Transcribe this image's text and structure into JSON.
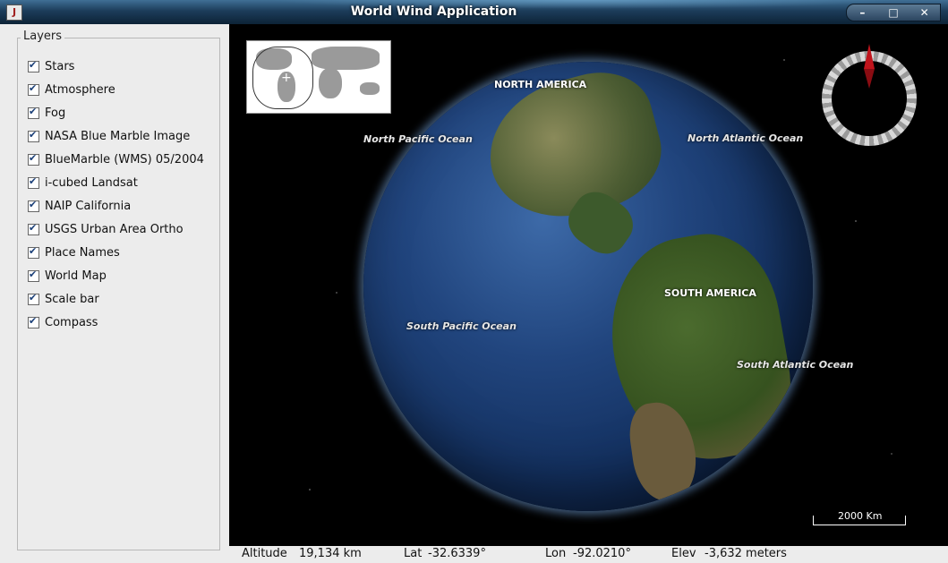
{
  "window": {
    "title": "World Wind Application"
  },
  "window_controls": {
    "minimize": "–",
    "maximize": "□",
    "close": "✕"
  },
  "layers_panel": {
    "title": "Layers",
    "items": [
      {
        "label": "Stars",
        "checked": true
      },
      {
        "label": "Atmosphere",
        "checked": true
      },
      {
        "label": "Fog",
        "checked": true
      },
      {
        "label": "NASA Blue Marble Image",
        "checked": true
      },
      {
        "label": "BlueMarble (WMS) 05/2004",
        "checked": true
      },
      {
        "label": "i-cubed Landsat",
        "checked": true
      },
      {
        "label": "NAIP California",
        "checked": true
      },
      {
        "label": "USGS Urban Area Ortho",
        "checked": true
      },
      {
        "label": "Place Names",
        "checked": true
      },
      {
        "label": "World Map",
        "checked": true
      },
      {
        "label": "Scale bar",
        "checked": true
      },
      {
        "label": "Compass",
        "checked": true
      }
    ]
  },
  "globe": {
    "labels": {
      "north_america": "NORTH AMERICA",
      "south_america": "SOUTH AMERICA",
      "north_pacific": "North Pacific Ocean",
      "north_atlantic": "North Atlantic Ocean",
      "south_pacific": "South Pacific Ocean",
      "south_atlantic": "South Atlantic Ocean"
    },
    "scale_bar": "2000 Km"
  },
  "status": {
    "altitude_label": "Altitude",
    "altitude_value": "19,134 km",
    "lat_label": "Lat",
    "lat_value": "-32.6339°",
    "lon_label": "Lon",
    "lon_value": "-92.0210°",
    "elev_label": "Elev",
    "elev_value": "-3,632 meters"
  },
  "colors": {
    "titlebar": "#1c3c5a",
    "panel": "#ececec",
    "globe_ocean": "#21457e",
    "compass_needle": "#c0141c"
  }
}
